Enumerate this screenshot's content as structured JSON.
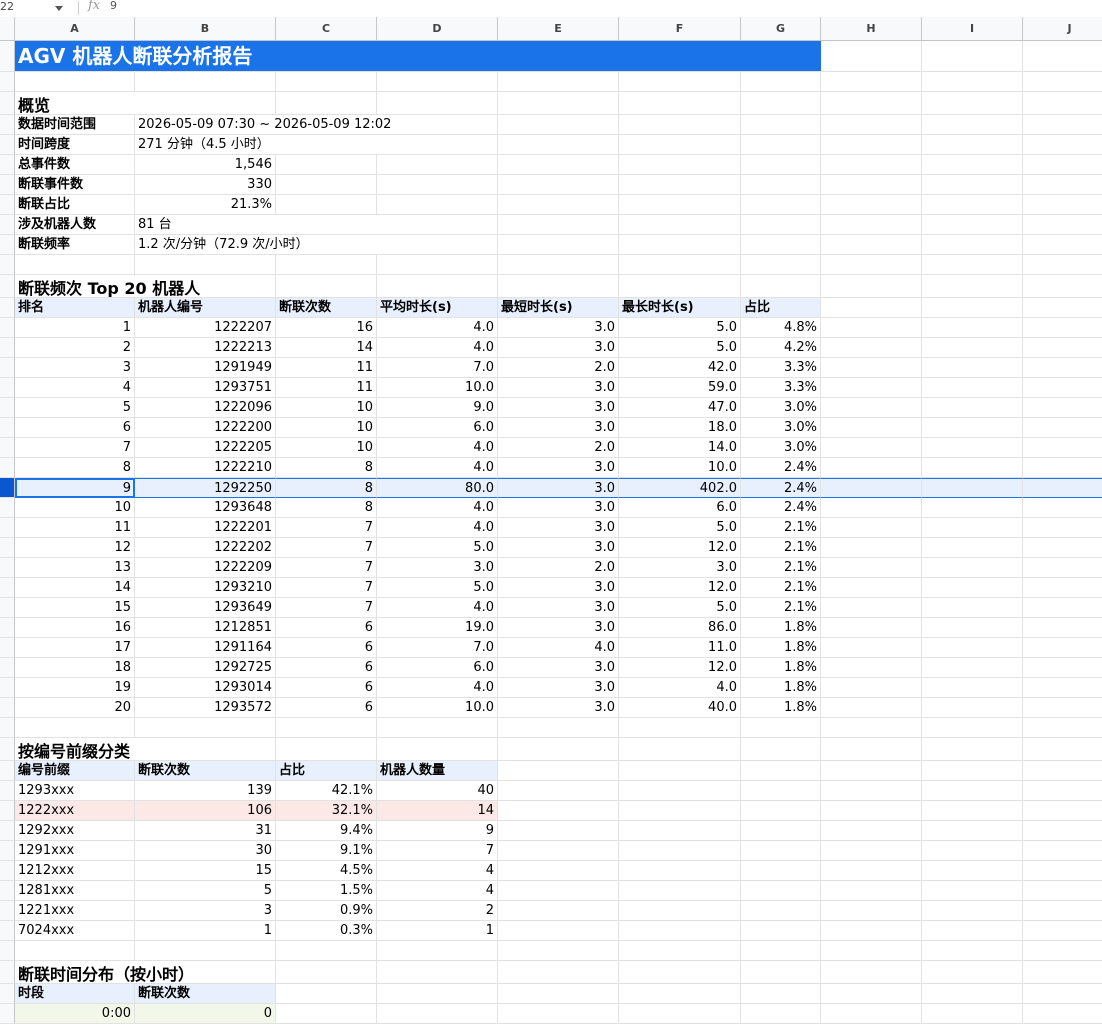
{
  "formula_bar": {
    "cell_ref": "22",
    "formula_value": "9"
  },
  "columns": [
    "A",
    "B",
    "C",
    "D",
    "E",
    "F",
    "G",
    "H",
    "I",
    "J"
  ],
  "title": "AGV 机器人断联分析报告",
  "overview": {
    "heading": "概览",
    "rows": [
      {
        "label": "数据时间范围",
        "value": "2026-05-09 07:30 ~ 2026-05-09 12:02",
        "align": "left"
      },
      {
        "label": "时间跨度",
        "value": "271 分钟（4.5 小时）",
        "align": "left"
      },
      {
        "label": "总事件数",
        "value": "1,546",
        "align": "right"
      },
      {
        "label": "断联事件数",
        "value": "330",
        "align": "right"
      },
      {
        "label": "断联占比",
        "value": "21.3%",
        "align": "right"
      },
      {
        "label": "涉及机器人数",
        "value": "81 台",
        "align": "left"
      },
      {
        "label": "断联频率",
        "value": "1.2 次/分钟（72.9 次/小时）",
        "align": "left"
      }
    ]
  },
  "top20": {
    "heading": "断联频次 Top 20 机器人",
    "headers": [
      "排名",
      "机器人编号",
      "断联次数",
      "平均时长(s)",
      "最短时长(s)",
      "最长时长(s)",
      "占比"
    ],
    "rows": [
      [
        "1",
        "1222207",
        "16",
        "4.0",
        "3.0",
        "5.0",
        "4.8%"
      ],
      [
        "2",
        "1222213",
        "14",
        "4.0",
        "3.0",
        "5.0",
        "4.2%"
      ],
      [
        "3",
        "1291949",
        "11",
        "7.0",
        "2.0",
        "42.0",
        "3.3%"
      ],
      [
        "4",
        "1293751",
        "11",
        "10.0",
        "3.0",
        "59.0",
        "3.3%"
      ],
      [
        "5",
        "1222096",
        "10",
        "9.0",
        "3.0",
        "47.0",
        "3.0%"
      ],
      [
        "6",
        "1222200",
        "10",
        "6.0",
        "3.0",
        "18.0",
        "3.0%"
      ],
      [
        "7",
        "1222205",
        "10",
        "4.0",
        "2.0",
        "14.0",
        "3.0%"
      ],
      [
        "8",
        "1222210",
        "8",
        "4.0",
        "3.0",
        "10.0",
        "2.4%"
      ],
      [
        "9",
        "1292250",
        "8",
        "80.0",
        "3.0",
        "402.0",
        "2.4%"
      ],
      [
        "10",
        "1293648",
        "8",
        "4.0",
        "3.0",
        "6.0",
        "2.4%"
      ],
      [
        "11",
        "1222201",
        "7",
        "4.0",
        "3.0",
        "5.0",
        "2.1%"
      ],
      [
        "12",
        "1222202",
        "7",
        "5.0",
        "3.0",
        "12.0",
        "2.1%"
      ],
      [
        "13",
        "1222209",
        "7",
        "3.0",
        "2.0",
        "3.0",
        "2.1%"
      ],
      [
        "14",
        "1293210",
        "7",
        "5.0",
        "3.0",
        "12.0",
        "2.1%"
      ],
      [
        "15",
        "1293649",
        "7",
        "4.0",
        "3.0",
        "5.0",
        "2.1%"
      ],
      [
        "16",
        "1212851",
        "6",
        "19.0",
        "3.0",
        "86.0",
        "1.8%"
      ],
      [
        "17",
        "1291164",
        "6",
        "7.0",
        "4.0",
        "11.0",
        "1.8%"
      ],
      [
        "18",
        "1292725",
        "6",
        "6.0",
        "3.0",
        "12.0",
        "1.8%"
      ],
      [
        "19",
        "1293014",
        "6",
        "4.0",
        "3.0",
        "4.0",
        "1.8%"
      ],
      [
        "20",
        "1293572",
        "6",
        "10.0",
        "3.0",
        "40.0",
        "1.8%"
      ]
    ]
  },
  "prefix": {
    "heading": "按编号前缀分类",
    "headers": [
      "编号前缀",
      "断联次数",
      "占比",
      "机器人数量"
    ],
    "rows": [
      [
        "1293xxx",
        "139",
        "42.1%",
        "40"
      ],
      [
        "1222xxx",
        "106",
        "32.1%",
        "14"
      ],
      [
        "1292xxx",
        "31",
        "9.4%",
        "9"
      ],
      [
        "1291xxx",
        "30",
        "9.1%",
        "7"
      ],
      [
        "1212xxx",
        "15",
        "4.5%",
        "4"
      ],
      [
        "1281xxx",
        "5",
        "1.5%",
        "4"
      ],
      [
        "1221xxx",
        "3",
        "0.9%",
        "2"
      ],
      [
        "7024xxx",
        "1",
        "0.3%",
        "1"
      ]
    ]
  },
  "hourly": {
    "heading": "断联时间分布（按小时）",
    "headers": [
      "时段",
      "断联次数"
    ],
    "rows": [
      [
        "0:00",
        "0"
      ]
    ]
  }
}
